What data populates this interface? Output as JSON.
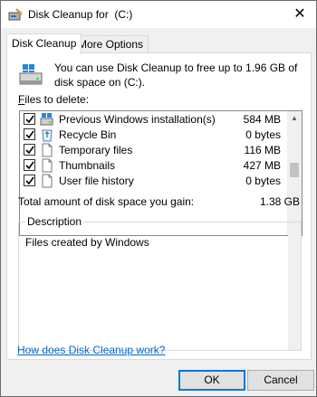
{
  "window": {
    "title": "Disk Cleanup for  (C:)",
    "close_glyph": "✕"
  },
  "tabs": [
    {
      "label": "Disk Cleanup",
      "active": true
    },
    {
      "label": "More Options",
      "active": false
    }
  ],
  "info_text": "You can use Disk Cleanup to free up to 1.96 GB of disk space on  (C:).",
  "files_label": {
    "accel": "F",
    "rest": "iles to delete:"
  },
  "files": [
    {
      "label": "Previous Windows installation(s)",
      "size": "584 MB",
      "checked": true,
      "icon": "windows-installation-icon"
    },
    {
      "label": "Recycle Bin",
      "size": "0 bytes",
      "checked": true,
      "icon": "recycle-bin-icon"
    },
    {
      "label": "Temporary files",
      "size": "116 MB",
      "checked": true,
      "icon": "file-icon"
    },
    {
      "label": "Thumbnails",
      "size": "427 MB",
      "checked": true,
      "icon": "file-icon"
    },
    {
      "label": "User file history",
      "size": "0 bytes",
      "checked": true,
      "icon": "file-icon"
    }
  ],
  "total": {
    "label": "Total amount of disk space you gain:",
    "value": "1.38 GB"
  },
  "description": {
    "title": "Description",
    "text": "Files created by Windows"
  },
  "link_text": "How does Disk Cleanup work?",
  "buttons": {
    "ok": "OK",
    "cancel": "Cancel"
  },
  "colors": {
    "accent": "#0078d7",
    "link": "#0066cc",
    "dialog_bg": "#f0f0f0"
  }
}
